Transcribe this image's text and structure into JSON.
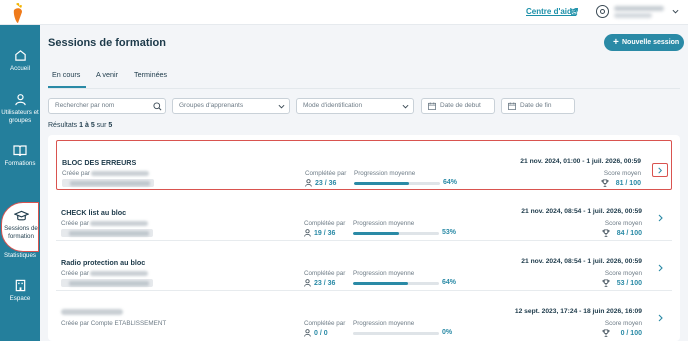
{
  "topbar": {
    "help_label": "Centre d'aide"
  },
  "sidebar": {
    "items": [
      {
        "label": "Accueil",
        "icon": "home-icon"
      },
      {
        "label": "Utilisateurs et groupes",
        "icon": "user-icon"
      },
      {
        "label": "Formations",
        "icon": "book-icon"
      },
      {
        "label": "Sessions de formation",
        "icon": "graduation-cap-icon",
        "active": true
      },
      {
        "label": "Statistiques",
        "icon": "chart-icon"
      },
      {
        "label": "Espace",
        "icon": "building-icon"
      }
    ]
  },
  "page": {
    "title": "Sessions de formation",
    "new_button": "Nouvelle session"
  },
  "tabs": [
    {
      "label": "En cours",
      "active": true
    },
    {
      "label": "A venir"
    },
    {
      "label": "Terminées"
    }
  ],
  "filters": {
    "search_placeholder": "Rechercher par nom",
    "groups_placeholder": "Groupes d'apprenants",
    "mode_placeholder": "Mode d'identification",
    "start_placeholder": "Date de debut",
    "end_placeholder": "Date de fin"
  },
  "results": {
    "prefix": "Résultats",
    "range": "1 à 5",
    "sep": "sur",
    "total": "5"
  },
  "labels": {
    "created_by": "Créée par",
    "completed_by": "Complétée par",
    "avg_progress": "Progression moyenne",
    "avg_score": "Score moyen"
  },
  "sessions": [
    {
      "title": "BLOC DES ERREURS",
      "created_by": "",
      "completed": "23 / 36",
      "progress": 64,
      "progress_label": "64%",
      "date": "21 nov. 2024, 01:00 - 1 juil. 2026, 00:59",
      "score": "81 / 100",
      "selected": true
    },
    {
      "title": "CHECK list au bloc",
      "created_by": "",
      "completed": "19 / 36",
      "progress": 53,
      "progress_label": "53%",
      "date": "21 nov. 2024, 08:54 - 1 juil. 2026, 00:59",
      "score": "84 / 100"
    },
    {
      "title": "Radio protection au bloc",
      "created_by": "",
      "completed": "23 / 36",
      "progress": 64,
      "progress_label": "64%",
      "date": "21 nov. 2024, 08:54 - 1 juil. 2026, 00:59",
      "score": "53 / 100"
    },
    {
      "title": "",
      "created_by": "Créée par Compte ETABLISSEMENT",
      "completed": "0 / 0",
      "progress": 0,
      "progress_label": "0%",
      "date": "12 sept. 2023, 17:24 - 18 juin 2026, 16:09",
      "score": "0 / 100"
    }
  ],
  "colors": {
    "sidebar": "#247f9c",
    "accent": "#2a8aa6",
    "highlight": "#d9534f"
  }
}
